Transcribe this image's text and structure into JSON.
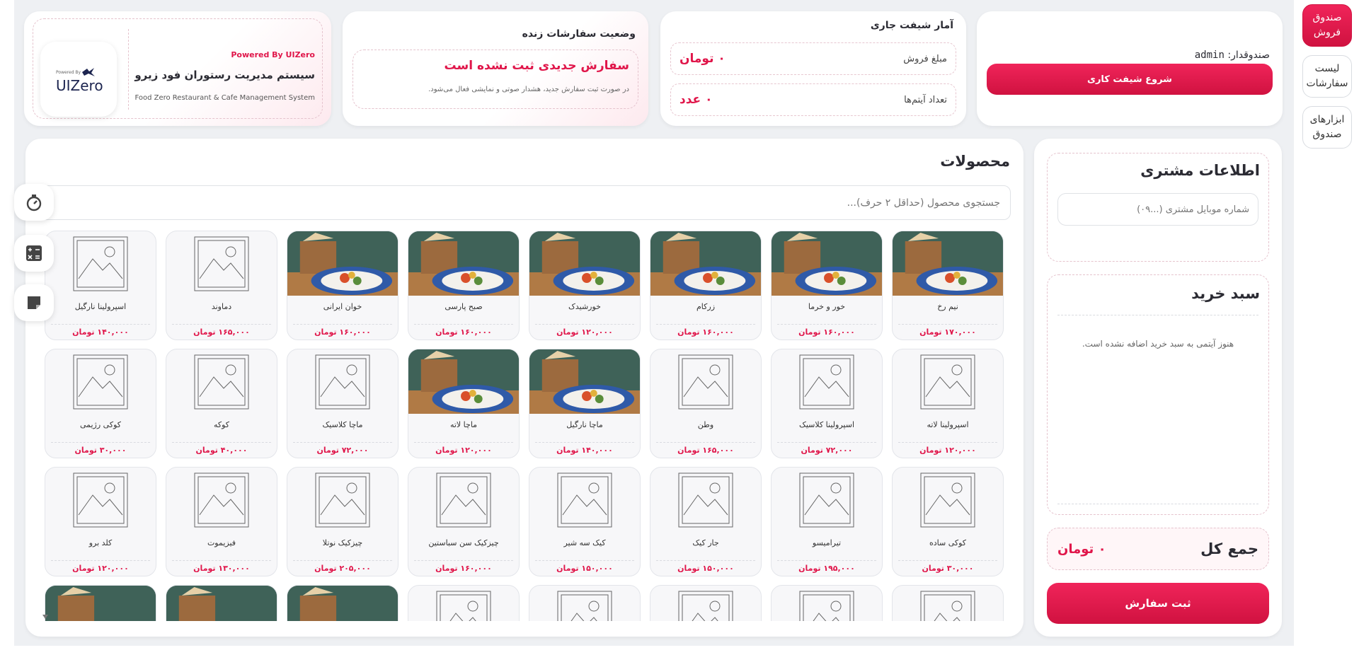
{
  "nav": {
    "items": [
      {
        "label": "صندوق فروش",
        "active": true
      },
      {
        "label": "لیست سفارشات",
        "active": false
      },
      {
        "label": "ابزارهای صندوق",
        "active": false
      }
    ]
  },
  "cashier": {
    "label": "صندوقدار:",
    "name": "admin",
    "start_shift_label": "شروع شیفت کاری"
  },
  "shift_stats": {
    "title": "آمار شیفت جاری",
    "sales_label": "مبلغ فروش",
    "sales_value": "۰ تومان",
    "items_label": "تعداد آیتم‌ها",
    "items_value": "۰ عدد"
  },
  "live_orders": {
    "title": "وضعیت سفارشات زنده",
    "status": "سفارش جدیدی ثبت نشده است",
    "note": "در صورت ثبت سفارش جدید، هشدار صوتی و نمایشی فعال می‌شود."
  },
  "brand": {
    "powered": "Powered By UIZero",
    "title": "سیستم مدیریت رستوران فود زیرو",
    "subtitle": "Food Zero Restaurant & Cafe Management System",
    "logo_small": "Powered By",
    "logo_text": "UIZero"
  },
  "customer": {
    "title": "اطلاعات مشتری",
    "phone_placeholder": "شماره موبایل مشتری (...۰۹)"
  },
  "cart": {
    "title": "سبد خرید",
    "empty": "هنوز آیتمی به سبد خرید اضافه نشده است.",
    "total_label": "جمع کل",
    "total_value": "۰ تومان",
    "submit_label": "ثبت سفارش"
  },
  "products": {
    "title": "محصولات",
    "search_placeholder": "جستجوی محصول (حداقل ۲ حرف)...",
    "rows": [
      [
        {
          "name": "نیم رخ",
          "price": "۱۷۰,۰۰۰ تومان",
          "photo": true
        },
        {
          "name": "خور و خرما",
          "price": "۱۶۰,۰۰۰ تومان",
          "photo": true
        },
        {
          "name": "زرکام",
          "price": "۱۶۰,۰۰۰ تومان",
          "photo": true
        },
        {
          "name": "خورشیدک",
          "price": "۱۲۰,۰۰۰ تومان",
          "photo": true
        },
        {
          "name": "صبح پارسی",
          "price": "۱۶۰,۰۰۰ تومان",
          "photo": true
        },
        {
          "name": "خوان ایرانی",
          "price": "۱۶۰,۰۰۰ تومان",
          "photo": true
        },
        {
          "name": "دماوند",
          "price": "۱۶۵,۰۰۰ تومان",
          "photo": false
        },
        {
          "name": "اسپرولینا نارگیل",
          "price": "۱۴۰,۰۰۰ تومان",
          "photo": false
        }
      ],
      [
        {
          "name": "اسپرولینا لاته",
          "price": "۱۲۰,۰۰۰ تومان",
          "photo": false
        },
        {
          "name": "اسپرولینا کلاسیک",
          "price": "۷۲,۰۰۰ تومان",
          "photo": false
        },
        {
          "name": "وطن",
          "price": "۱۶۵,۰۰۰ تومان",
          "photo": false
        },
        {
          "name": "ماچا نارگیل",
          "price": "۱۴۰,۰۰۰ تومان",
          "photo": true
        },
        {
          "name": "ماچا لاته",
          "price": "۱۲۰,۰۰۰ تومان",
          "photo": true
        },
        {
          "name": "ماچا کلاسیک",
          "price": "۷۲,۰۰۰ تومان",
          "photo": false
        },
        {
          "name": "کوکه",
          "price": "۴۰,۰۰۰ تومان",
          "photo": false
        },
        {
          "name": "کوکی رژیمی",
          "price": "۳۰,۰۰۰ تومان",
          "photo": false
        }
      ],
      [
        {
          "name": "کوکی ساده",
          "price": "۳۰,۰۰۰ تومان",
          "photo": false
        },
        {
          "name": "تیرامیسو",
          "price": "۱۹۵,۰۰۰ تومان",
          "photo": false
        },
        {
          "name": "جار کیک",
          "price": "۱۵۰,۰۰۰ تومان",
          "photo": false
        },
        {
          "name": "کیک سه شیر",
          "price": "۱۵۰,۰۰۰ تومان",
          "photo": false
        },
        {
          "name": "چیزکیک سن سباستین",
          "price": "۱۶۰,۰۰۰ تومان",
          "photo": false
        },
        {
          "name": "چیزکیک نوتلا",
          "price": "۲۰۵,۰۰۰ تومان",
          "photo": false
        },
        {
          "name": "فیزیموت",
          "price": "۱۳۰,۰۰۰ تومان",
          "photo": false
        },
        {
          "name": "کلد برو",
          "price": "۱۲۰,۰۰۰ تومان",
          "photo": false
        }
      ],
      [
        {
          "name": "",
          "price": "",
          "photo": false
        },
        {
          "name": "",
          "price": "",
          "photo": false
        },
        {
          "name": "",
          "price": "",
          "photo": false
        },
        {
          "name": "",
          "price": "",
          "photo": false
        },
        {
          "name": "",
          "price": "",
          "photo": false
        },
        {
          "name": "",
          "price": "",
          "photo": true
        },
        {
          "name": "",
          "price": "",
          "photo": true
        },
        {
          "name": "",
          "price": "",
          "photo": true
        }
      ]
    ]
  },
  "floating_tools": [
    {
      "icon": "timer-icon"
    },
    {
      "icon": "calculator-icon"
    },
    {
      "icon": "note-icon"
    }
  ],
  "colors": {
    "accent": "#e0164a",
    "background": "#eef0f3"
  }
}
